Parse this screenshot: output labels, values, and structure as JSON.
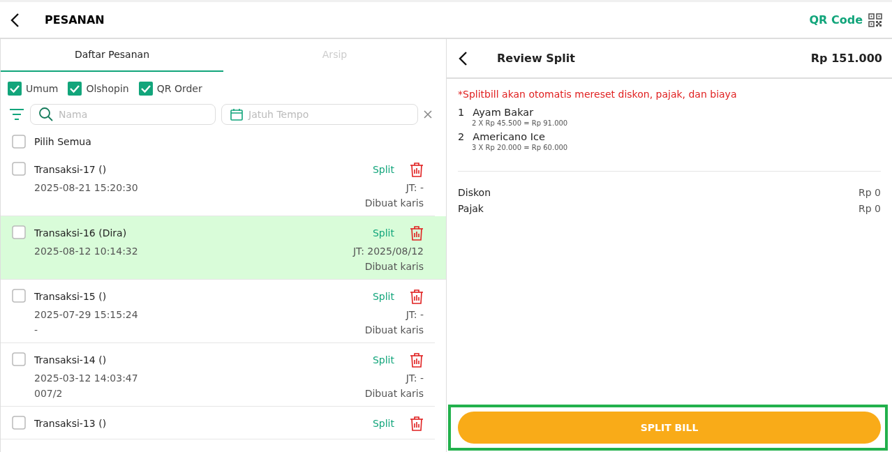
{
  "header": {
    "title": "PESANAN",
    "qr_label": "QR Code"
  },
  "tabs": [
    {
      "label": "Daftar Pesanan",
      "selected": true
    },
    {
      "label": "Arsip",
      "selected": false
    }
  ],
  "filters": [
    {
      "label": "Umum",
      "checked": true
    },
    {
      "label": "Olshopin",
      "checked": true
    },
    {
      "label": "QR Order",
      "checked": true
    }
  ],
  "search": {
    "placeholder": "Nama"
  },
  "due_date": {
    "placeholder": "Jatuh Tempo"
  },
  "select_all": {
    "label": "Pilih Semua",
    "checked": false
  },
  "orders": [
    {
      "name": "Transaksi-17 ()",
      "date": "2025-08-21 15:20:30",
      "due": "JT: -",
      "creator": "Dibuat karis",
      "action": "Split",
      "checked": false,
      "selected": false
    },
    {
      "name": "Transaksi-16 (Dira)",
      "date": "2025-08-12 10:14:32",
      "due": "JT: 2025/08/12",
      "creator": "Dibuat karis",
      "action": "Split",
      "checked": false,
      "selected": true
    },
    {
      "name": "Transaksi-15 ()",
      "date": "2025-07-29 15:15:24",
      "note": "-",
      "due": "JT: -",
      "creator": "Dibuat karis",
      "action": "Split",
      "checked": false,
      "selected": false
    },
    {
      "name": "Transaksi-14 ()",
      "date": "2025-03-12 14:03:47",
      "note": "007/2",
      "due": "JT: -",
      "creator": "Dibuat karis",
      "action": "Split",
      "checked": false,
      "selected": false
    },
    {
      "name": "Transaksi-13 ()",
      "action": "Split",
      "checked": false,
      "selected": false
    }
  ],
  "review": {
    "title": "Review Split",
    "total": "Rp 151.000",
    "warning": "*Splitbill akan otomatis mereset diskon, pajak, dan biaya",
    "items": [
      {
        "qty": "1",
        "name": "Ayam Bakar",
        "detail": "2 X Rp 45.500 = Rp 91.000"
      },
      {
        "qty": "2",
        "name": "Americano Ice",
        "detail": "3 X Rp 20.000 = Rp 60.000"
      }
    ],
    "summary": [
      {
        "label": "Diskon",
        "value": "Rp 0"
      },
      {
        "label": "Pajak",
        "value": "Rp 0"
      }
    ],
    "button": "SPLIT BILL"
  }
}
